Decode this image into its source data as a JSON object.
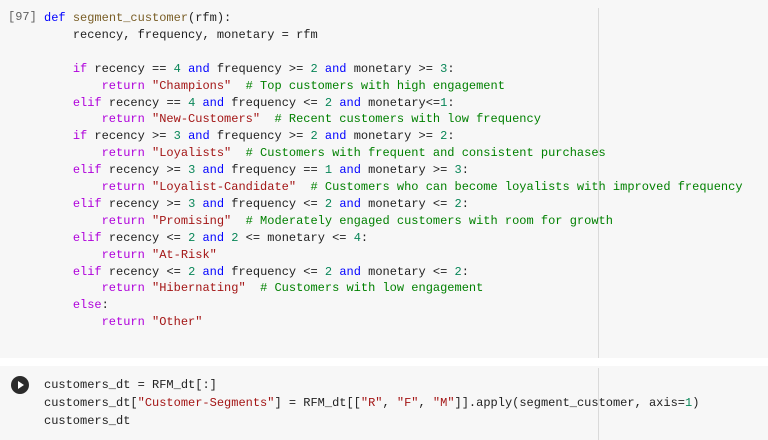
{
  "cell1": {
    "execution_count": "[97]",
    "lines": [
      "def segment_customer(rfm):",
      "    recency, frequency, monetary = rfm",
      "",
      "    if recency == 4 and frequency >= 2 and monetary >= 3:",
      "        return \"Champions\"  # Top customers with high engagement",
      "    elif recency == 4 and frequency <= 2 and monetary<=1:",
      "        return \"New-Customers\"  # Recent customers with low frequency",
      "    if recency >= 3 and frequency >= 2 and monetary >= 2:",
      "        return \"Loyalists\"  # Customers with frequent and consistent purchases",
      "    elif recency >= 3 and frequency == 1 and monetary >= 3:",
      "        return \"Loyalist-Candidate\"  # Customers who can become loyalists with improved frequency",
      "    elif recency >= 3 and frequency <= 2 and monetary <= 2:",
      "        return \"Promising\"  # Moderately engaged customers with room for growth",
      "    elif recency <= 2 and 2 <= monetary <= 4:",
      "        return \"At-Risk\"",
      "    elif recency <= 2 and frequency <= 2 and monetary <= 2:",
      "        return \"Hibernating\"  # Customers with low engagement",
      "    else:",
      "        return \"Other\""
    ]
  },
  "cell2": {
    "run_icon": "play-icon",
    "lines": [
      "customers_dt = RFM_dt[:]",
      "customers_dt[\"Customer-Segments\"] = RFM_dt[[\"R\", \"F\", \"M\"]].apply(segment_customer, axis=1)",
      "customers_dt"
    ]
  },
  "colors": {
    "keyword": "#0000ff",
    "control": "#af00db",
    "string": "#a31515",
    "comment": "#008000",
    "number": "#098658",
    "cell_background": "#f7f7f7"
  }
}
